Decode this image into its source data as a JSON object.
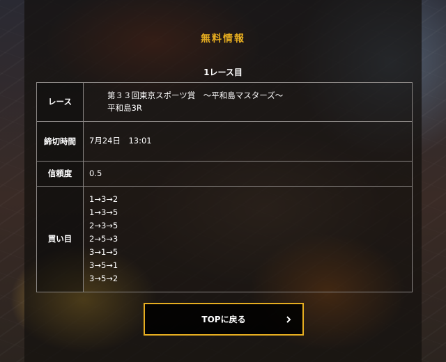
{
  "header": {
    "title": "無料情報",
    "race_label": "1レース目"
  },
  "table": {
    "race": {
      "label": "レース",
      "name": "第３３回東京スポーツ賞　～平和島マスターズ～",
      "venue_race": "平和島3R"
    },
    "deadline": {
      "label": "締切時間",
      "value": "7月24日　13:01"
    },
    "reliability": {
      "label": "信頼度",
      "value": "0.5"
    },
    "bets": {
      "label": "買い目",
      "items": [
        "1→3→2",
        "1→3→5",
        "2→3→5",
        "2→5→3",
        "3→1→5",
        "3→5→1",
        "3→5→2"
      ]
    }
  },
  "button": {
    "label": "TOPに戻る",
    "icon": "chevron-right-icon"
  },
  "colors": {
    "accent": "#e6ad20"
  }
}
